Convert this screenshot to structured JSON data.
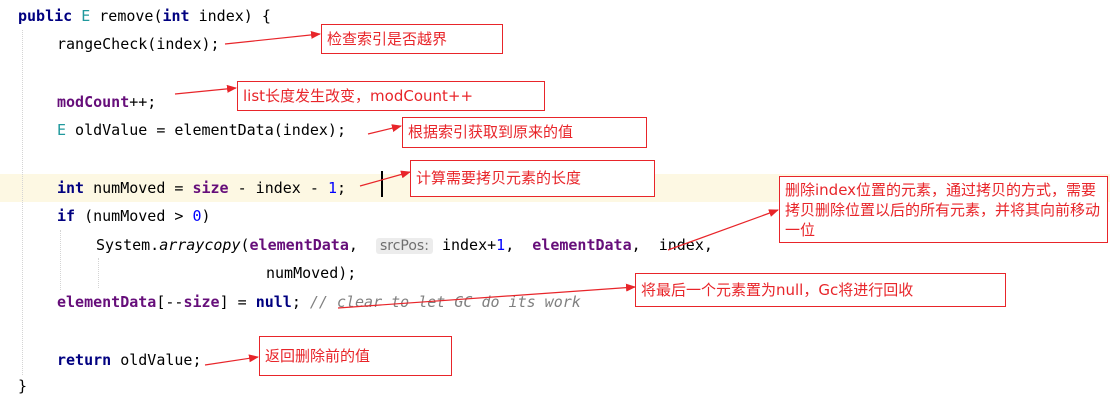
{
  "code": {
    "l1": {
      "kw1": "public",
      "type": "E",
      "rest": " remove(",
      "kw2": "int",
      "rest2": " index) {"
    },
    "l2": {
      "text": "rangeCheck(index);"
    },
    "l3": {
      "fld": "modCount",
      "rest": "++;"
    },
    "l4": {
      "type": "E",
      "rest": " oldValue = elementData(index);"
    },
    "l5": {
      "kw": "int",
      "a": " numMoved = ",
      "fld": "size",
      "b": " - index - ",
      "num": "1",
      "c": ";"
    },
    "l6": {
      "kw": "if",
      "a": " (numMoved > ",
      "num": "0",
      "b": ")"
    },
    "l7": {
      "a": "System.",
      "method": "arraycopy",
      "b": "(",
      "fld1": "elementData",
      "c": ",  ",
      "hint": "srcPos:",
      "d": " index+",
      "num": "1",
      "e": ",  ",
      "fld2": "elementData",
      "f": ",  index,"
    },
    "l8": {
      "text": "numMoved);"
    },
    "l9": {
      "fld1": "elementData",
      "a": "[--",
      "fld2": "size",
      "b": "] = ",
      "kw": "null",
      "c": ";",
      "comment": " // clear to let GC do its work"
    },
    "l10": {
      "kw": "return",
      "a": " oldValue;"
    },
    "l11": {
      "text": "}"
    }
  },
  "notes": {
    "n1": "检查索引是否越界",
    "n2": "list长度发生改变，modCount++",
    "n3": "根据索引获取到原来的值",
    "n4": "计算需要拷贝元素的长度",
    "n5": "删除index位置的元素，通过拷贝的方式，需要拷贝删除位置以后的所有元素，并将其向前移动一位",
    "n6": "将最后一个元素置为null，Gc将进行回收",
    "n7": "返回删除前的值"
  },
  "colors": {
    "annotation": "#e8252a",
    "keyword": "#000080",
    "field": "#660e7a",
    "number": "#0000ff",
    "current_line": "#fdf8e3"
  }
}
